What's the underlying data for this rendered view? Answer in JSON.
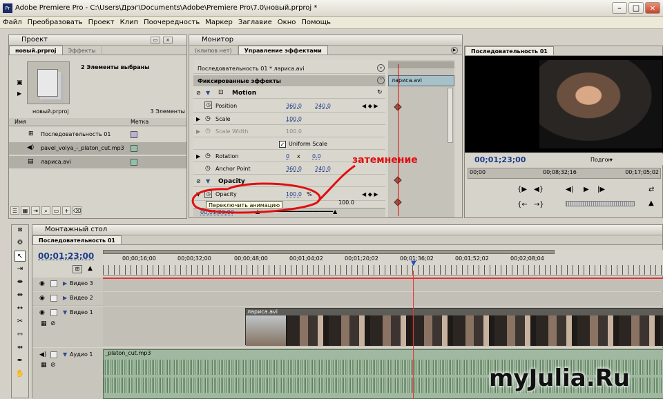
{
  "app": {
    "title": "Adobe Premiere Pro - C:\\Users\\Дрэг\\Documents\\Adobe\\Premiere Pro\\7.0\\новый.prproj *",
    "menu": [
      "Файл",
      "Преобразовать",
      "Проект",
      "Клип",
      "Поочередность",
      "Маркер",
      "Заглавие",
      "Окно",
      "Помощь"
    ]
  },
  "project": {
    "panel_title": "Проект",
    "tabs": [
      "новый.prproj",
      "Эффекты"
    ],
    "selection_info": "2 Элементы выбраны",
    "project_file": "новый.prproj",
    "item_count": "3 Элементы",
    "col_name": "Имя",
    "col_label": "Метка",
    "items": [
      {
        "name": "Последовательность 01"
      },
      {
        "name": "pavel_volya_-_platon_cut.mp3"
      },
      {
        "name": "лариса.avi"
      }
    ]
  },
  "monitor": {
    "panel_title": "Монитор",
    "tabs": [
      "(клипов нет)",
      "Управление эффектами"
    ],
    "clip_path": "Последовательность 01 * лариса.avi",
    "section": "Фиксированные эффекты",
    "mini_clip": "лариса.avi",
    "motion": "Motion",
    "position": {
      "label": "Position",
      "x": "360.0",
      "y": "240.0"
    },
    "scale": {
      "label": "Scale",
      "v": "100.0"
    },
    "scale_width": {
      "label": "Scale Width",
      "v": "100.0"
    },
    "uniform": "Uniform Scale",
    "rotation": {
      "label": "Rotation",
      "v": "0",
      "x": "x",
      "deg": "0.0"
    },
    "anchor": {
      "label": "Anchor Point",
      "x": "360.0",
      "y": "240.0"
    },
    "opacity_section": "Opacity",
    "opacity": {
      "label": "Opacity",
      "v": "100.0",
      "unit": "%"
    },
    "tooltip": "Переключить анимацию",
    "graph_val": "100.0",
    "timecode": "00;01;23;00",
    "annotation": "затемнение"
  },
  "program": {
    "tab": "Последовательность 01",
    "timecode": "00;01;23;00",
    "fit": "Подгон",
    "ruler_start": "00;00",
    "ruler_mid": "00;08;32;16",
    "ruler_end": "00;17;05;02"
  },
  "timeline": {
    "panel_title": "Монтажный стол",
    "tab": "Последовательность 01",
    "timecode": "00;01;23;00",
    "ruler": [
      "00;00;16;00",
      "00;00;32;00",
      "00;00;48;00",
      "00;01;04;02",
      "00;01;20;02",
      "00;01;36;02",
      "00;01;52;02",
      "00;02;08;04"
    ],
    "tracks": {
      "v3": "Видео 3",
      "v2": "Видео 2",
      "v1": "Видео 1",
      "a1": "Аудио 1"
    },
    "video_clip": "лариса.avi",
    "audio_clip": "_platon_cut.mp3"
  },
  "watermark": "myJulia.Ru"
}
